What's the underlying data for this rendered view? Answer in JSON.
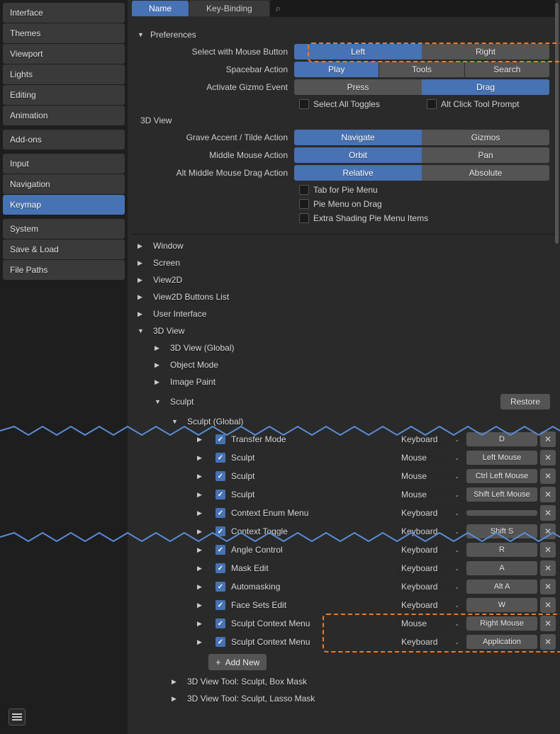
{
  "sidebar": {
    "groups": [
      [
        "Interface",
        "Themes",
        "Viewport",
        "Lights",
        "Editing",
        "Animation"
      ],
      [
        "Add-ons"
      ],
      [
        "Input",
        "Navigation",
        "Keymap"
      ],
      [
        "System",
        "Save & Load",
        "File Paths"
      ]
    ],
    "active": "Keymap"
  },
  "tabs": {
    "name": "Name",
    "keybinding": "Key-Binding",
    "active": "Name"
  },
  "prefs": {
    "title": "Preferences",
    "select_mouse": {
      "label": "Select with Mouse Button",
      "left": "Left",
      "right": "Right",
      "active": "Left"
    },
    "spacebar": {
      "label": "Spacebar Action",
      "play": "Play",
      "tools": "Tools",
      "search": "Search",
      "active": "Play"
    },
    "gizmo": {
      "label": "Activate Gizmo Event",
      "press": "Press",
      "drag": "Drag",
      "active": "Drag"
    },
    "select_all": "Select All Toggles",
    "alt_click": "Alt Click Tool Prompt",
    "section_3d": "3D View",
    "grave": {
      "label": "Grave Accent / Tilde Action",
      "navigate": "Navigate",
      "gizmos": "Gizmos",
      "active": "Navigate"
    },
    "mmb": {
      "label": "Middle Mouse Action",
      "orbit": "Orbit",
      "pan": "Pan",
      "active": "Orbit"
    },
    "alt_mmb": {
      "label": "Alt Middle Mouse Drag Action",
      "relative": "Relative",
      "absolute": "Absolute",
      "active": "Relative"
    },
    "tab_pie": "Tab for Pie Menu",
    "pie_drag": "Pie Menu on Drag",
    "extra_shading": "Extra Shading Pie Menu Items"
  },
  "tree": {
    "window": "Window",
    "screen": "Screen",
    "view2d": "View2D",
    "view2d_buttons": "View2D Buttons List",
    "ui": "User Interface",
    "view3d": "3D View",
    "view3d_global": "3D View (Global)",
    "object_mode": "Object Mode",
    "image_paint": "Image Paint",
    "sculpt": "Sculpt",
    "sculpt_global": "Sculpt (Global)",
    "restore": "Restore",
    "tool_box": "3D View Tool: Sculpt, Box Mask",
    "tool_lasso": "3D View Tool: Sculpt, Lasso Mask",
    "add_new": "Add New"
  },
  "keymaps": [
    {
      "name": "Transfer Mode",
      "input": "Keyboard",
      "key": "D"
    },
    {
      "name": "Sculpt",
      "input": "Mouse",
      "key": "Left Mouse"
    },
    {
      "name": "Sculpt",
      "input": "Mouse",
      "key": "Ctrl Left Mouse"
    },
    {
      "name": "Sculpt",
      "input": "Mouse",
      "key": "Shift Left Mouse"
    },
    {
      "name": "Context Enum Menu",
      "input": "Keyboard",
      "key": ""
    },
    {
      "name": "Context Toggle",
      "input": "Keyboard",
      "key": "Shift S"
    },
    {
      "name": "Angle Control",
      "input": "Keyboard",
      "key": "R"
    },
    {
      "name": "Mask Edit",
      "input": "Keyboard",
      "key": "A"
    },
    {
      "name": "Automasking",
      "input": "Keyboard",
      "key": "Alt A"
    },
    {
      "name": "Face Sets Edit",
      "input": "Keyboard",
      "key": "W"
    },
    {
      "name": "Sculpt Context Menu",
      "input": "Mouse",
      "key": "Right Mouse"
    },
    {
      "name": "Sculpt Context Menu",
      "input": "Keyboard",
      "key": "Application"
    }
  ]
}
